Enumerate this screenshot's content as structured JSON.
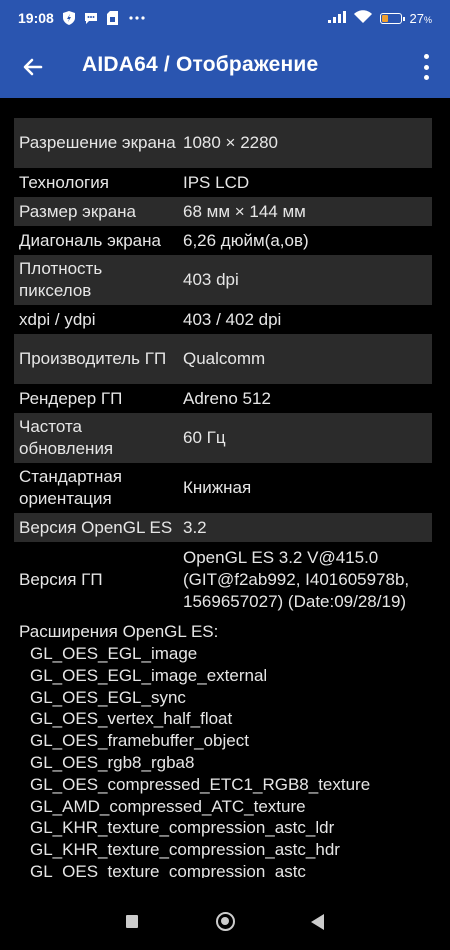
{
  "status_bar": {
    "time": "19:08",
    "battery_percent": "27",
    "battery_unit": "%",
    "icons": [
      "shield-icon",
      "chat-icon",
      "sim-icon",
      "more-dots-icon",
      "signal-icon",
      "wifi-icon",
      "battery-icon"
    ]
  },
  "app_bar": {
    "title": "AIDA64  /  Отображение",
    "back_icon": "arrow-left-icon",
    "menu_icon": "more-vert-icon"
  },
  "properties": [
    {
      "key": "Разрешение экрана",
      "value": "1080 × 2280"
    },
    {
      "key": "Технология",
      "value": "IPS LCD"
    },
    {
      "key": "Размер экрана",
      "value": "68 мм × 144 мм"
    },
    {
      "key": "Диагональ экрана",
      "value": "6,26 дюйм(а,ов)"
    },
    {
      "key": "Плотность пикселов",
      "value": "403 dpi"
    },
    {
      "key": "xdpi / ydpi",
      "value": "403 / 402 dpi"
    },
    {
      "key": "Производитель ГП",
      "value": "Qualcomm"
    },
    {
      "key": "Рендерер ГП",
      "value": "Adreno 512"
    },
    {
      "key": "Частота обновления",
      "value": "60 Гц"
    },
    {
      "key": "Стандартная ориентация",
      "value": "Книжная"
    },
    {
      "key": "Версия OpenGL ES",
      "value": "3.2"
    },
    {
      "key": "Версия ГП",
      "value": "OpenGL ES 3.2 V@415.0 (GIT@f2ab992, I401605978b, 1569657027) (Date:09/28/19)"
    }
  ],
  "extensions": {
    "title": "Расширения OpenGL ES:",
    "items": [
      "GL_OES_EGL_image",
      "GL_OES_EGL_image_external",
      "GL_OES_EGL_sync",
      "GL_OES_vertex_half_float",
      "GL_OES_framebuffer_object",
      "GL_OES_rgb8_rgba8",
      "GL_OES_compressed_ETC1_RGB8_texture",
      "GL_AMD_compressed_ATC_texture",
      "GL_KHR_texture_compression_astc_ldr",
      "GL_KHR_texture_compression_astc_hdr",
      "GL_OES_texture_compression_astc"
    ]
  },
  "nav_bar": {
    "icons": [
      "recents-square-icon",
      "home-circle-icon",
      "back-triangle-icon"
    ]
  },
  "colors": {
    "header": "#2a55b0",
    "background": "#000000",
    "row_shade": "#2b2b2b",
    "text": "#e6e6e6"
  }
}
